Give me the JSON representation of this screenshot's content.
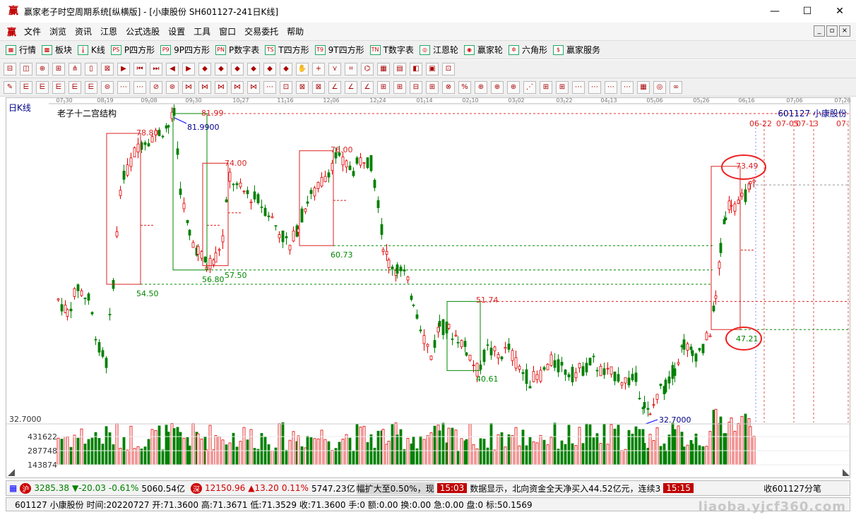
{
  "window": {
    "title": "赢家老子时空周期系统[纵横版] - [小康股份  SH601127-241日K线]",
    "min": "—",
    "max": "☐",
    "close": "✕"
  },
  "menu": [
    "文件",
    "浏览",
    "资讯",
    "江恩",
    "公式选股",
    "设置",
    "工具",
    "窗口",
    "交易委托",
    "帮助"
  ],
  "toolbar1": [
    "行情",
    "板块",
    "K线",
    "P四方形",
    "9P四方形",
    "P数字表",
    "T四方形",
    "9T四方形",
    "T数字表",
    "江恩轮",
    "赢家轮",
    "六角形",
    "赢家服务"
  ],
  "chart": {
    "period_label": "日K线",
    "indicator_label": "老子十二宫结构",
    "stock_label": "601127  小康股份",
    "date_ticks": [
      "07-30",
      "08-19",
      "09-08",
      "09-30",
      "10-27",
      "11-16",
      "12-06",
      "12-24",
      "01-14",
      "02-10",
      "03-02",
      "03-22",
      "04-13",
      "05-06",
      "05-26",
      "06-16",
      "07-06",
      "07-26"
    ],
    "future_dates": [
      "06-22",
      "07-05",
      "07-13",
      "07-"
    ],
    "low_axis_label": "32.7000",
    "vol_axis": [
      "431622",
      "287748",
      "143874"
    ],
    "labels": {
      "high1": "81.99",
      "high1b": "81.9900",
      "l7880": "78.80",
      "l7400": "74.00",
      "l7600": "76.00",
      "l5450": "54.50",
      "l5680": "56.80",
      "l5750": "57.50",
      "l6073": "60.73",
      "l5174": "51.74",
      "l4061": "40.61",
      "low": "32.7000",
      "l7349": "73.49",
      "l4721": "47.21"
    }
  },
  "status1": {
    "sh_index": "3285.38",
    "sh_change": "▼-20.03",
    "sh_pct": "-0.61%",
    "sh_amount": "5060.54亿",
    "sz_index": "12150.96",
    "sz_change": "▲13.20",
    "sz_pct": "0.11%",
    "sz_amount": "5747.23亿",
    "news1": "幅扩大至0.50%，现",
    "time1": "15:03",
    "news2": "数据显示，北向资金全天净买入44.52亿元，连续3",
    "time2": "15:15",
    "right": "收601127分笔"
  },
  "status2": {
    "text": "601127 小康股份 时间:20220727 开:71.3600 高:71.3671 低:71.3529 收:71.3600 手:0 额:0.00 换:0.00 急:0.00 盘:0 标:50.1569"
  },
  "watermark": "liaoba.yjcf360.com"
}
